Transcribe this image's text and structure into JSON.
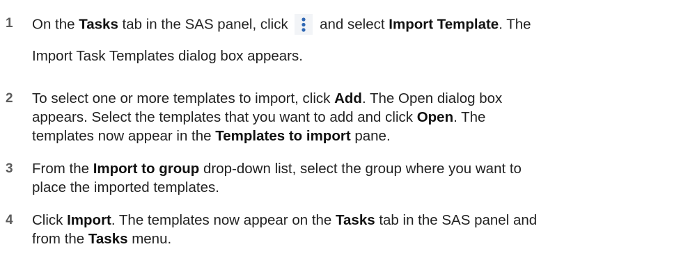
{
  "steps": [
    {
      "number": "1",
      "seg1": "On the ",
      "b1": "Tasks",
      "seg2": " tab in the SAS panel, click ",
      "icon": "kebab-menu-icon",
      "seg3": " and select ",
      "b2": "Import Template",
      "seg4": ". The",
      "line2": "Import Task Templates dialog box appears."
    },
    {
      "number": "2",
      "seg1": "To select one or more templates to import, click ",
      "b1": "Add",
      "seg2": ". The Open dialog box",
      "line2_seg1": "appears. Select the templates that you want to add and click ",
      "line2_b1": "Open",
      "line2_seg2": ". The",
      "line3_seg1": "templates now appear in the ",
      "line3_b1": "Templates to import",
      "line3_seg2": " pane."
    },
    {
      "number": "3",
      "seg1": "From the ",
      "b1": "Import to group",
      "seg2": " drop-down list, select the group where you want to",
      "line2": "place the imported templates."
    },
    {
      "number": "4",
      "seg1": "Click ",
      "b1": "Import",
      "seg2": ". The templates now appear on the ",
      "b2": "Tasks",
      "seg3": " tab in the SAS panel and",
      "line2_seg1": "from the ",
      "line2_b1": "Tasks",
      "line2_seg2": " menu."
    }
  ],
  "colors": {
    "text": "#222222",
    "step_number": "#5c5c5c",
    "icon": "#2f67b3"
  }
}
